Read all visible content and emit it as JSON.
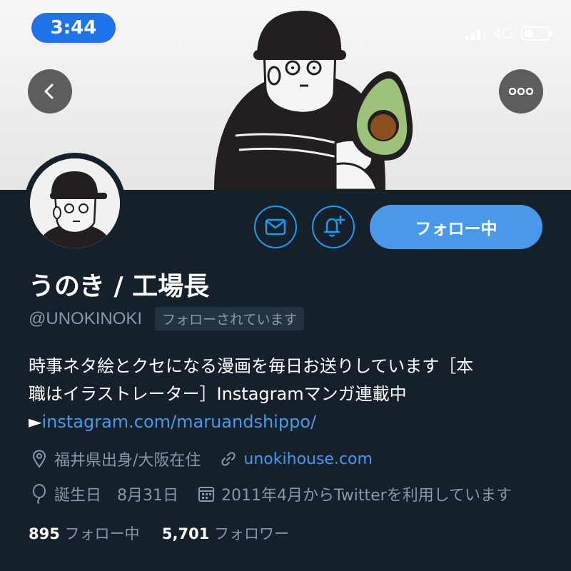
{
  "status_bar": {
    "time": "3:44",
    "network": "4G",
    "battery_level": 0.25,
    "signal_bars": 3
  },
  "header": {
    "back_icon": "chevron-left-icon",
    "more_icon": "more-horizontal-icon"
  },
  "profile": {
    "name": "うのき / 工場長",
    "handle": "@UNOKINOKI",
    "follows_you": "フォローされています",
    "follow_button": "フォロー中",
    "message_icon": "mail-icon",
    "notify_icon": "bell-plus-icon",
    "bio": {
      "line1": "時事ネタ絵とクセになる漫画を毎日お送りしています［本",
      "line2": "職はイラストレーター］Instagramマンガ連載中",
      "arrow": "►",
      "link": "instagram.com/maruandshippo/"
    },
    "location": "福井県出身/大阪在住",
    "website": "unokihouse.com",
    "birthday": "誕生日　8月31日",
    "joined": "2011年4月からTwitterを利用しています",
    "following_count": "895",
    "following_label": "フォロー中",
    "followers_count": "5,701",
    "followers_label": "フォロワー"
  },
  "colors": {
    "background": "#15202b",
    "accent": "#1d9bf0",
    "follow_button": "#4a98e9",
    "muted": "#8899a6"
  }
}
